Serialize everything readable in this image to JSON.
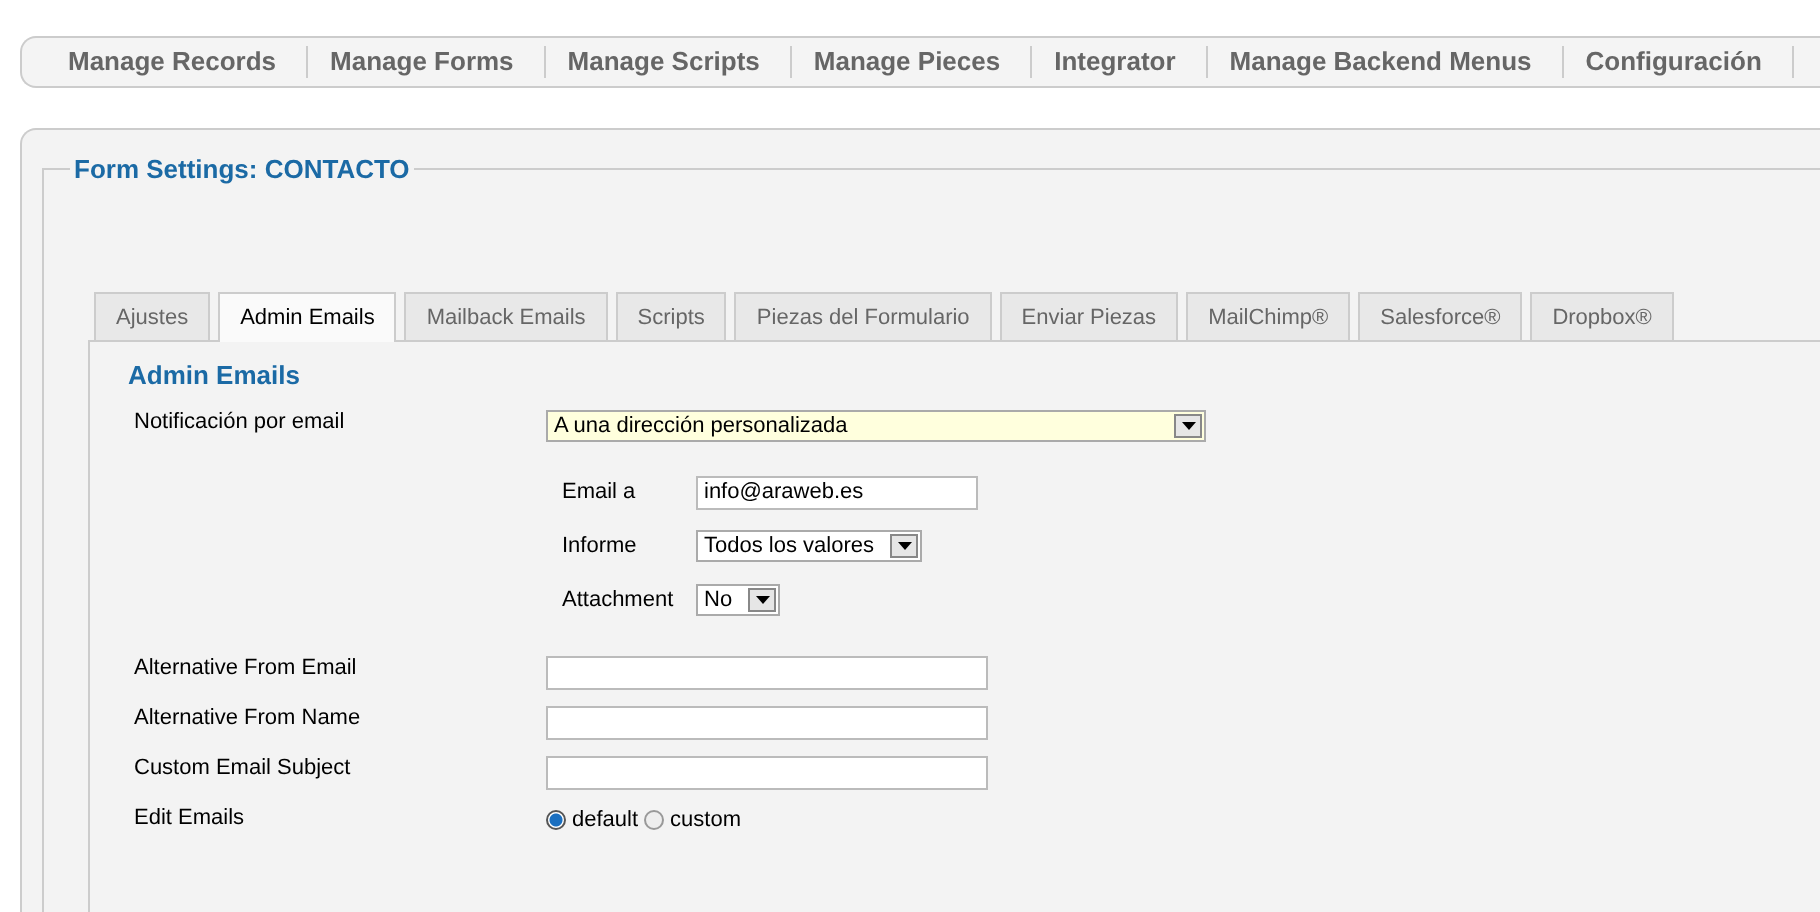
{
  "menu": [
    {
      "label": "Manage Records"
    },
    {
      "label": "Manage Forms"
    },
    {
      "label": "Manage Scripts"
    },
    {
      "label": "Manage Pieces"
    },
    {
      "label": "Integrator"
    },
    {
      "label": "Manage Backend Menus"
    },
    {
      "label": "Configuración"
    }
  ],
  "form_title": "Form Settings: CONTACTO",
  "tabs": [
    {
      "label": "Ajustes",
      "selected": false
    },
    {
      "label": "Admin Emails",
      "selected": true
    },
    {
      "label": "Mailback Emails",
      "selected": false
    },
    {
      "label": "Scripts",
      "selected": false
    },
    {
      "label": "Piezas del Formulario",
      "selected": false
    },
    {
      "label": "Enviar Piezas",
      "selected": false
    },
    {
      "label": "MailChimp®",
      "selected": false
    },
    {
      "label": "Salesforce®",
      "selected": false
    },
    {
      "label": "Dropbox®",
      "selected": false
    }
  ],
  "section_title": "Admin Emails",
  "fields": [
    {
      "kind": "select",
      "label": "Notificación por email",
      "value": "A una dirección personalizada",
      "highlighted": true,
      "sub_fields": [
        {
          "kind": "input",
          "label": "Email a",
          "value": "info@araweb.es"
        },
        {
          "kind": "select",
          "label": "Informe",
          "value": "Todos los valores"
        },
        {
          "kind": "select",
          "label": "Attachment",
          "value": "No"
        }
      ]
    },
    {
      "kind": "input",
      "label": "Alternative From Email"
    },
    {
      "kind": "input",
      "label": "Alternative From Name"
    },
    {
      "kind": "input",
      "label": "Custom Email Subject"
    },
    {
      "kind": "radio",
      "label": "Edit Emails",
      "options": [
        {
          "label": "default",
          "selected": true
        },
        {
          "label": "custom",
          "selected": false
        }
      ]
    }
  ]
}
